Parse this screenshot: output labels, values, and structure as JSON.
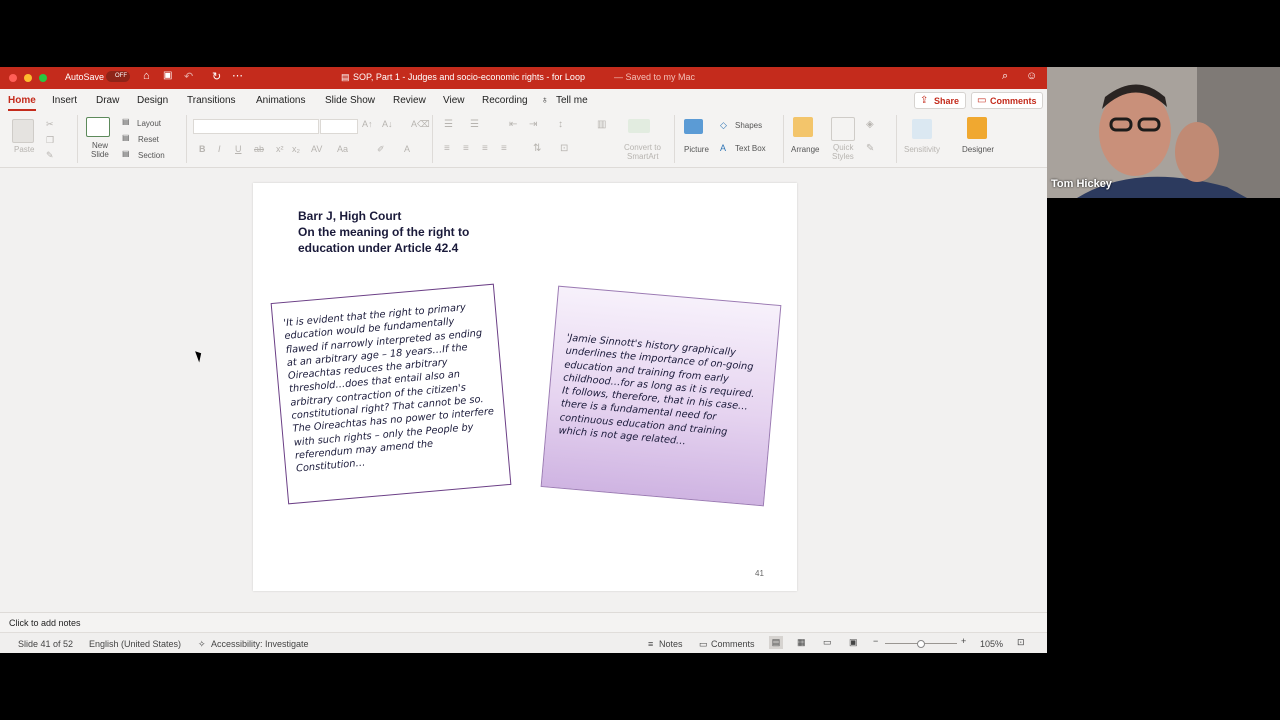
{
  "titlebar": {
    "autosave_label": "AutoSave",
    "autosave_state": "OFF",
    "doc_title": "SOP, Part 1 - Judges and socio-economic rights - for Loop",
    "saved_status": "— Saved to my Mac"
  },
  "tabs": [
    "Home",
    "Insert",
    "Draw",
    "Design",
    "Transitions",
    "Animations",
    "Slide Show",
    "Review",
    "View",
    "Recording"
  ],
  "tell_me": "Tell me",
  "share_label": "Share",
  "comments_label": "Comments",
  "ribbon": {
    "paste": "Paste",
    "new_slide_1": "New",
    "new_slide_2": "Slide",
    "layout": "Layout",
    "reset": "Reset",
    "section": "Section",
    "bold": "B",
    "italic": "I",
    "underline": "U",
    "strike": "ab",
    "convert_1": "Convert to",
    "convert_2": "SmartArt",
    "picture": "Picture",
    "shapes": "Shapes",
    "textbox": "Text Box",
    "arrange": "Arrange",
    "quick_1": "Quick",
    "quick_2": "Styles",
    "sensitivity": "Sensitivity",
    "designer": "Designer"
  },
  "slide": {
    "heading": [
      "Barr J, High Court",
      "On the meaning of the right to",
      "education under Article 42.4"
    ],
    "quote_left": "'It is evident that the right to primary education would be fundamentally flawed if narrowly interpreted as ending at an arbitrary age – 18 years…If the Oireachtas reduces the arbitrary threshold…does that entail also an arbitrary contraction of the citizen's constitutional right? That cannot be so. The Oireachtas has no power to interfere with such rights – only the People by referendum may amend the Constitution…",
    "quote_right": "'Jamie Sinnott's history graphically underlines the importance of on-going education and training from early childhood…for as long as it is required. It follows, therefore, that in his case…there is a fundamental need for continuous education and training which is not age related…",
    "page_number": "41"
  },
  "notes_placeholder": "Click to add notes",
  "status": {
    "slide_count": "Slide 41 of 52",
    "language": "English (United States)",
    "accessibility": "Accessibility: Investigate",
    "notes": "Notes",
    "comments": "Comments",
    "zoom": "105%"
  },
  "webcam": {
    "name": "Tom Hickey"
  },
  "colors": {
    "titlebar": "#c42b1c",
    "accent": "#c42b1c",
    "quote_border": "#6b3f86",
    "quote_fill": "#e6d4f0"
  }
}
